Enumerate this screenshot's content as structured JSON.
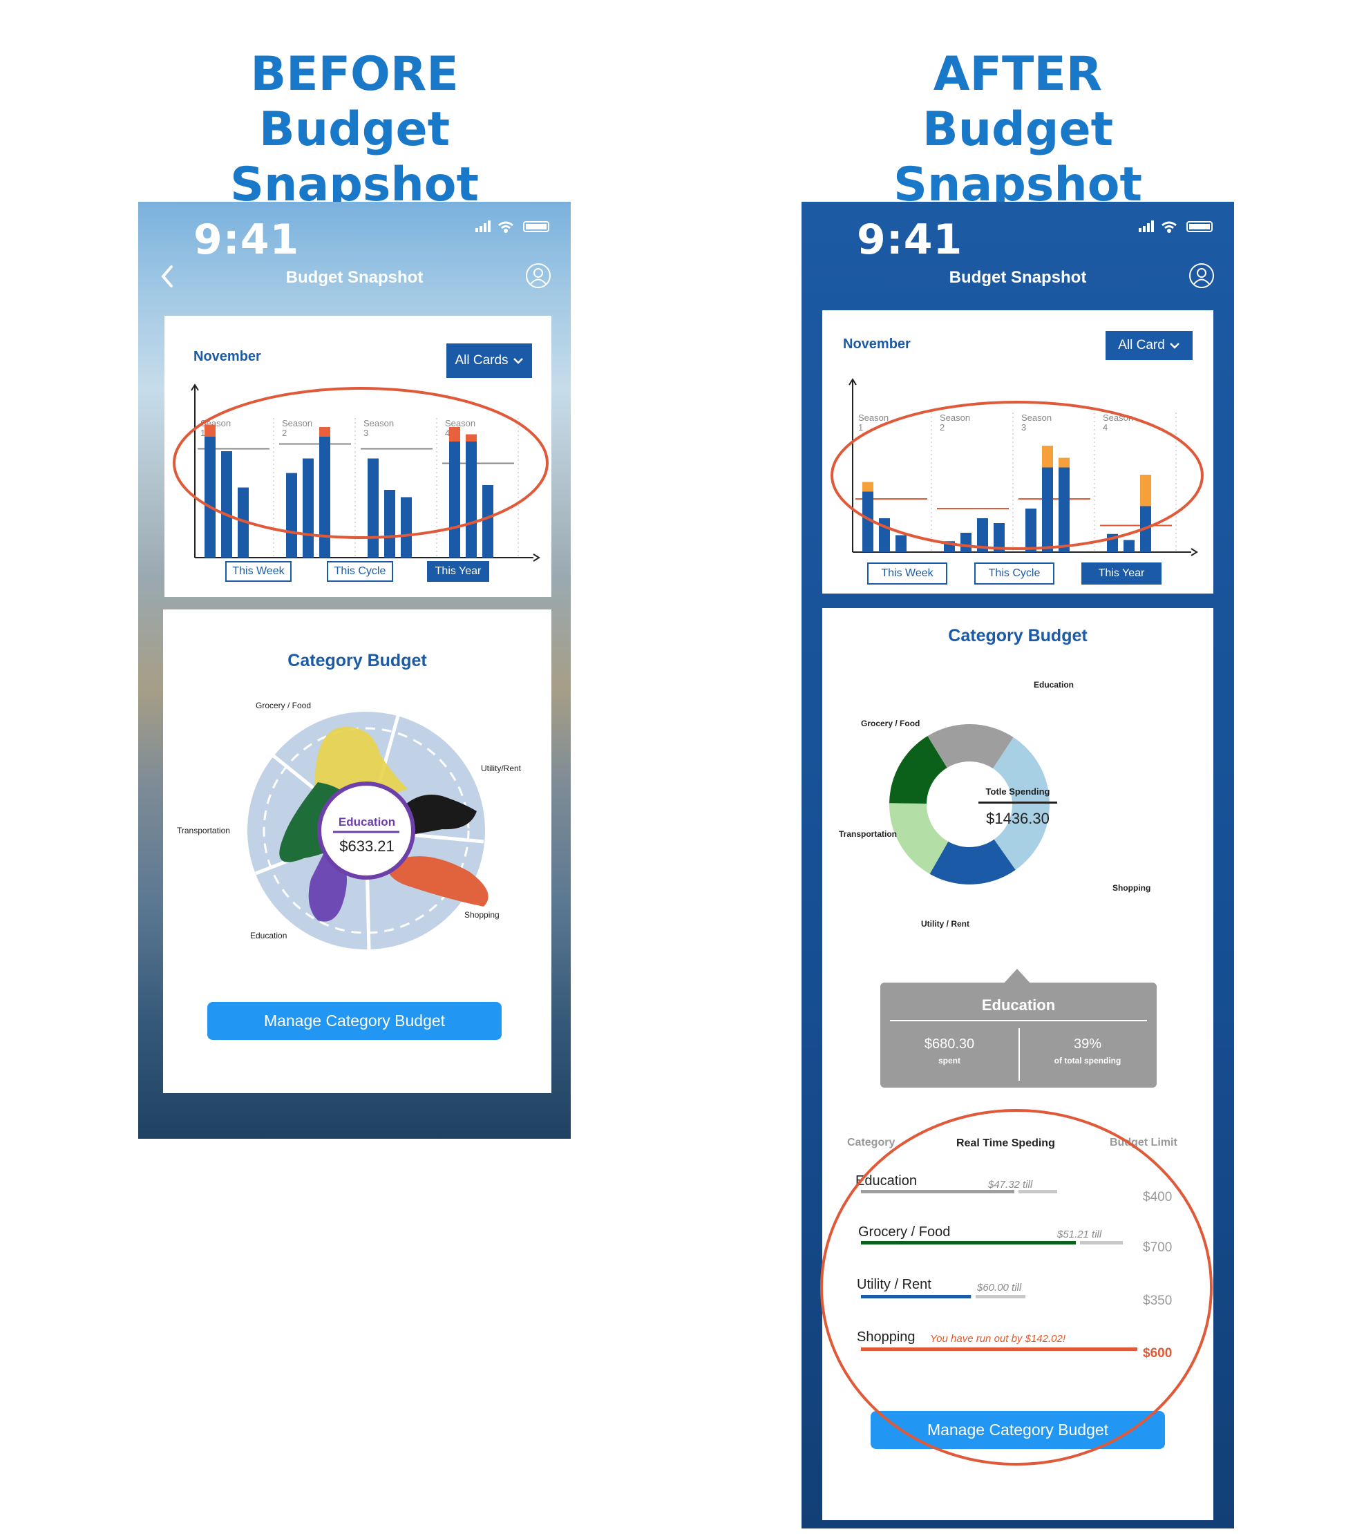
{
  "headings": {
    "before": {
      "line1": "BEFORE",
      "line2": "Budget Snapshot"
    },
    "after": {
      "line1": "AFTER",
      "line2": "Budget Snapshot"
    }
  },
  "colors": {
    "heading": "#1a78c8",
    "brand": "#1b5aa6",
    "accent_orange": "#f08a2c",
    "highlight_red": "#e05a3a",
    "button": "#2196f3"
  },
  "before": {
    "status_time": "9:41",
    "nav_title": "Budget Snapshot",
    "month": "November",
    "card_filter": "All Cards",
    "season_labels": [
      [
        "Season",
        "1"
      ],
      [
        "Season",
        "2"
      ],
      [
        "Season",
        "3"
      ],
      [
        "Season",
        "4"
      ]
    ],
    "range_buttons": [
      "This Week",
      "This Cycle",
      "This Year"
    ],
    "active_range": "This Year",
    "category_title": "Category Budget",
    "categories": [
      "Grocery / Food",
      "Utility/Rent",
      "Transportation",
      "Shopping",
      "Education"
    ],
    "center_label": "Education",
    "center_value": "$633.21",
    "manage_button": "Manage Category Budget",
    "chart_data": {
      "type": "bar",
      "groups": [
        "Season 1",
        "Season 2",
        "Season 3",
        "Season 4"
      ],
      "series": [
        {
          "values": [
            [
              100,
              88,
              58
            ],
            [
              70,
              82,
              100
            ],
            [
              82,
              56,
              50
            ],
            [
              96,
              96,
              60
            ]
          ]
        }
      ],
      "over_budget": [
        [
          10,
          0,
          0
        ],
        [
          0,
          0,
          8
        ],
        [
          0,
          0,
          0
        ],
        [
          12,
          6,
          0
        ]
      ],
      "budget_lines": [
        90,
        94,
        90,
        78
      ]
    }
  },
  "after": {
    "status_time": "9:41",
    "nav_title": "Budget Snapshot",
    "month": "November",
    "card_filter": "All Card",
    "season_labels": [
      [
        "Season",
        "1"
      ],
      [
        "Season",
        "2"
      ],
      [
        "Season",
        "3"
      ],
      [
        "Season",
        "4"
      ]
    ],
    "range_buttons": [
      "This Week",
      "This Cycle",
      "This Year"
    ],
    "active_range": "This Year",
    "category_title": "Category Budget",
    "donut_center_label": "Totle Spending",
    "donut_center_value": "$1436.30",
    "categories": [
      "Education",
      "Grocery / Food",
      "Transportation",
      "Shopping",
      "Utility / Rent"
    ],
    "chart_data": {
      "type": "bar",
      "groups": [
        "Season 1",
        "Season 2",
        "Season 3",
        "Season 4"
      ],
      "series": [
        {
          "values": [
            [
              50,
              28,
              14
            ],
            [
              9,
              16,
              28,
              24
            ],
            [
              36,
              70,
              70
            ],
            [
              15,
              10,
              38
            ]
          ]
        }
      ],
      "over_budget": [
        [
          8,
          0,
          0
        ],
        [
          0,
          0,
          0,
          0
        ],
        [
          0,
          18,
          8
        ],
        [
          0,
          0,
          26
        ]
      ],
      "budget_lines": [
        44,
        36,
        44,
        22
      ]
    },
    "donut_data": {
      "type": "pie",
      "slices": [
        {
          "label": "Education",
          "value": 18,
          "color": "#9e9e9e"
        },
        {
          "label": "Shopping",
          "value": 31,
          "color": "#a8d0e4"
        },
        {
          "label": "Utility / Rent",
          "value": 18,
          "color": "#1b5aa6"
        },
        {
          "label": "Transportation",
          "value": 17,
          "color": "#b3dfa6"
        },
        {
          "label": "Grocery / Food",
          "value": 16,
          "color": "#0b6119"
        }
      ]
    },
    "tooltip": {
      "title": "Education",
      "spent_value": "$680.30",
      "spent_label": "spent",
      "share_value": "39%",
      "share_label": "of total spending"
    },
    "list_headers": {
      "category": "Category",
      "spending": "Real Time Speding",
      "limit": "Budget Limit"
    },
    "rows": [
      {
        "name": "Education",
        "till": "$47.32 till",
        "limit": "$400",
        "color": "#9e9e9e",
        "progress": 0.78
      },
      {
        "name": "Grocery / Food",
        "till": "$51.21 till",
        "limit": "$700",
        "color": "#0b6119",
        "progress": 0.82
      },
      {
        "name": "Utility / Rent",
        "till": "$60.00 till",
        "limit": "$350",
        "color": "#1b5aa6",
        "progress": 0.67
      },
      {
        "name": "Shopping",
        "warning": "You have run out by $142.02!",
        "limit": "$600",
        "color": "#e05a3a",
        "progress": 1.0
      }
    ],
    "manage_button": "Manage Category Budget"
  }
}
